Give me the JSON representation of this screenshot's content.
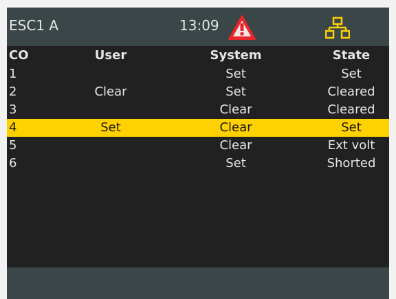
{
  "header": {
    "title": "ESC1 A",
    "time": "13:09",
    "alarm_icon": "warning-triangle-icon",
    "network_icon": "network-icon",
    "alarm_color": "#e8262a",
    "network_color": "#ffd100"
  },
  "table": {
    "columns": [
      "CO",
      "User",
      "System",
      "State"
    ],
    "rows": [
      {
        "co": "1",
        "user": "",
        "system": "Set",
        "state": "Set"
      },
      {
        "co": "2",
        "user": "Clear",
        "system": "Set",
        "state": "Cleared"
      },
      {
        "co": "3",
        "user": "",
        "system": "Clear",
        "state": "Cleared"
      },
      {
        "co": "4",
        "user": "Set",
        "system": "Clear",
        "state": "Set"
      },
      {
        "co": "5",
        "user": "",
        "system": "Clear",
        "state": "Ext volt"
      },
      {
        "co": "6",
        "user": "",
        "system": "Set",
        "state": "Shorted"
      }
    ],
    "selected_row": 4,
    "selected_color": "#ffd100"
  }
}
